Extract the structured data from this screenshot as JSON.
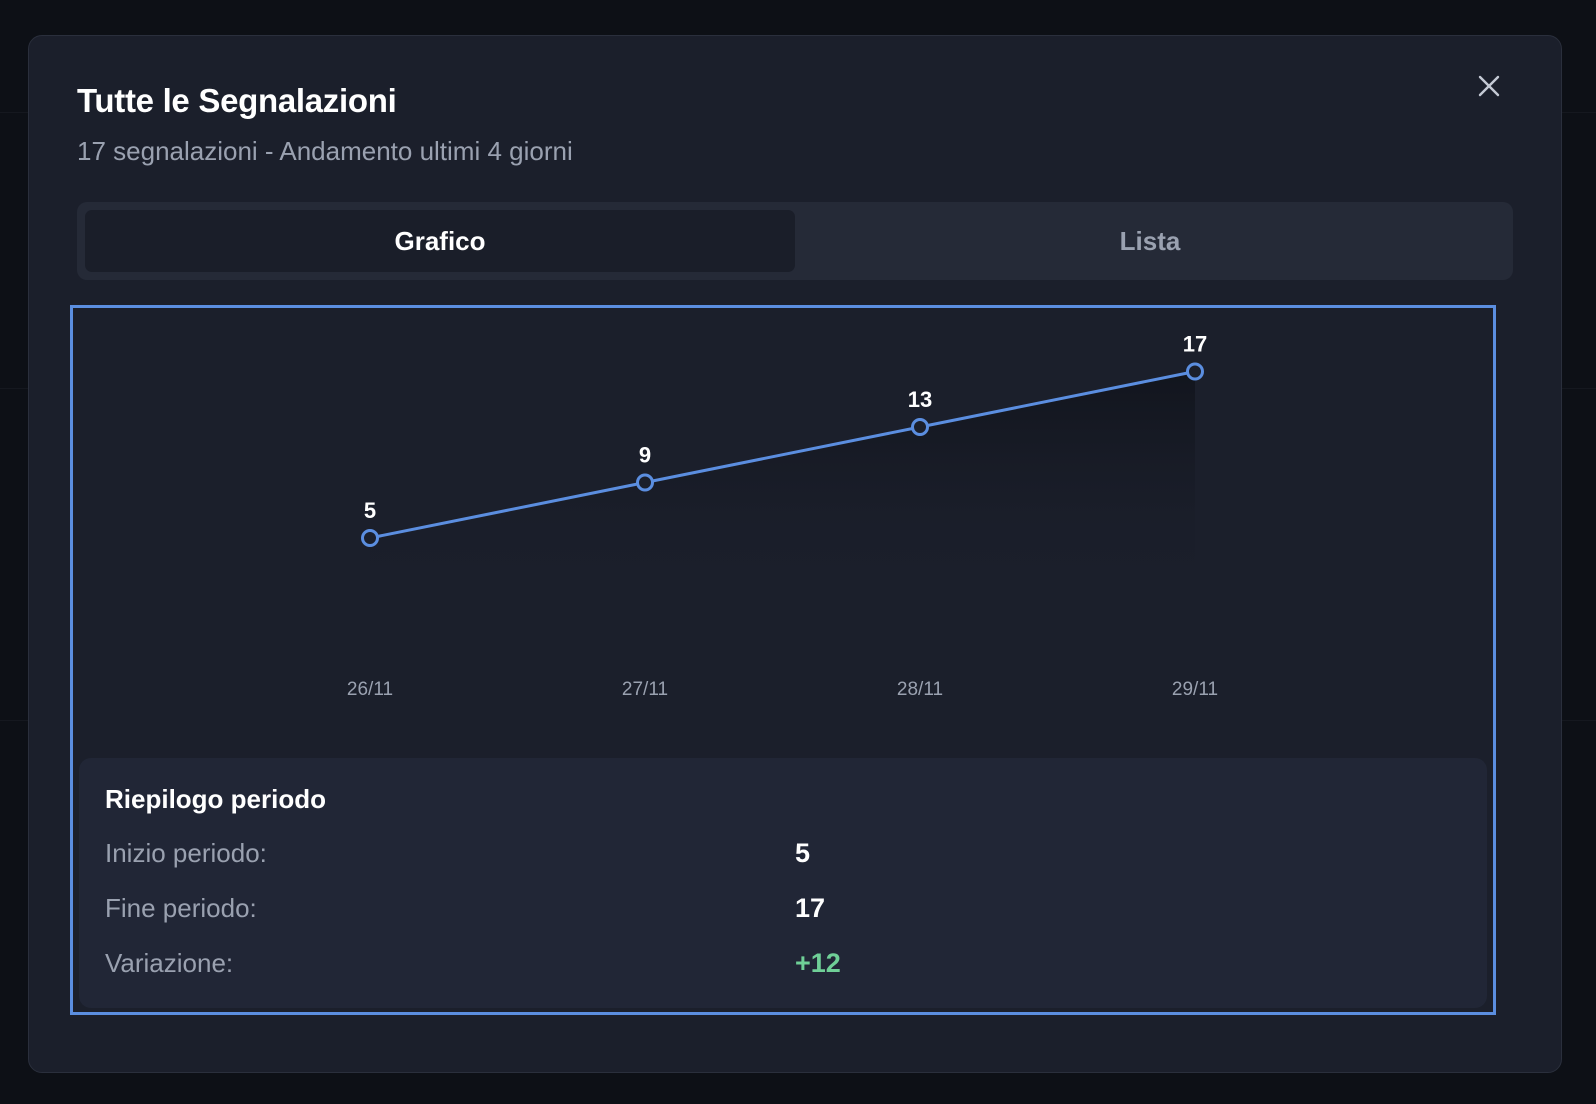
{
  "modal": {
    "title": "Tutte le Segnalazioni",
    "subtitle": "17 segnalazioni - Andamento ultimi 4 giorni",
    "close_icon": "close-icon"
  },
  "tabs": [
    {
      "label": "Grafico",
      "active": true
    },
    {
      "label": "Lista",
      "active": false
    }
  ],
  "chart_data": {
    "type": "line",
    "x": [
      "26/11",
      "27/11",
      "28/11",
      "29/11"
    ],
    "values": [
      5,
      9,
      13,
      17
    ],
    "data_labels": [
      "5",
      "9",
      "13",
      "17"
    ],
    "title": "",
    "xlabel": "",
    "ylabel": "",
    "ylim": [
      0,
      17
    ],
    "grid": false,
    "line_color": "#5b8ee0"
  },
  "summary": {
    "title": "Riepilogo periodo",
    "rows": [
      {
        "label": "Inizio periodo:",
        "value": "5"
      },
      {
        "label": "Fine periodo:",
        "value": "17"
      },
      {
        "label": "Variazione:",
        "value": "+12"
      }
    ],
    "positive_color": "#6fcf97"
  },
  "colors": {
    "modal_bg": "#1b1f2b",
    "accent": "#5b8ee0"
  }
}
